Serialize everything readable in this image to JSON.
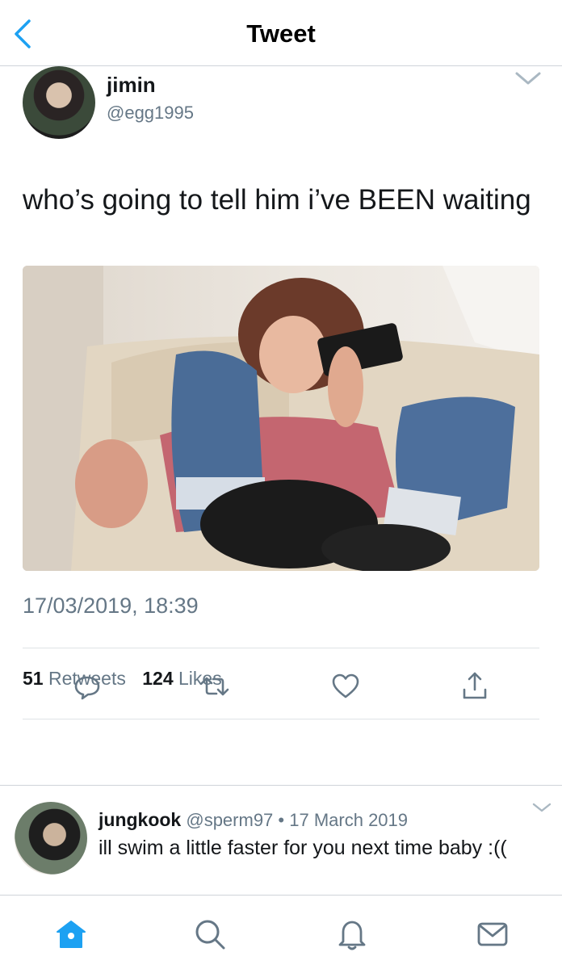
{
  "header": {
    "title": "Tweet",
    "back_icon": "chevron-left-icon"
  },
  "colors": {
    "accent": "#1da1f2",
    "muted": "#657786",
    "text": "#14171a",
    "divider": "#dfe3e6"
  },
  "tweet": {
    "author": {
      "name": "jimin",
      "handle": "@egg1995"
    },
    "text": "who’s going to tell him i’ve BEEN waiting",
    "timestamp": "17/03/2019, 18:39",
    "stats": {
      "retweets": "51",
      "retweets_label": "Retweets",
      "likes": "124",
      "likes_label": "Likes"
    },
    "actions": [
      "reply-icon",
      "retweet-icon",
      "like-icon",
      "share-icon"
    ]
  },
  "reply": {
    "author": {
      "name": "jungkook",
      "handle": "@sperm97"
    },
    "separator": "•",
    "date": "17 March 2019",
    "text": "ill swim a little faster for you next time baby :(("
  },
  "tabbar": {
    "items": [
      "home-icon",
      "search-icon",
      "notifications-icon",
      "messages-icon"
    ],
    "active": "home-icon"
  }
}
